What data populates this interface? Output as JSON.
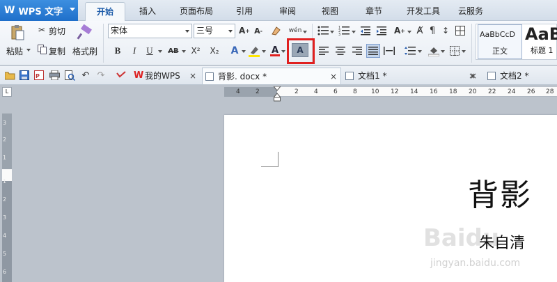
{
  "app": {
    "title": "WPS 文字"
  },
  "menu": {
    "tabs": [
      "开始",
      "插入",
      "页面布局",
      "引用",
      "审阅",
      "视图",
      "章节",
      "开发工具",
      "云服务"
    ]
  },
  "ribbon": {
    "paste_label": "粘贴",
    "cut_label": "剪切",
    "copy_label": "复制",
    "format_painter_label": "格式刷",
    "font_name": "宋体",
    "font_size": "三号",
    "bold": "B",
    "italic": "I",
    "underline": "U",
    "strikethrough": "AB",
    "superscript": "X²",
    "subscript": "X₂",
    "char_shading": "A",
    "styles": [
      {
        "preview": "AaBbCcD",
        "label": "正文"
      },
      {
        "preview": "AaB",
        "label": "标题 1"
      }
    ]
  },
  "doc_tabs": [
    {
      "name": "我的WPS",
      "close": "×"
    },
    {
      "name": "背影. docx *",
      "close": "×"
    },
    {
      "name": "文档1 *",
      "close": "×"
    },
    {
      "name": "文档2 *",
      "close": "×"
    }
  ],
  "ruler": {
    "h_ticks": [
      "4",
      "2",
      "2",
      "4",
      "6",
      "8",
      "10",
      "12",
      "14",
      "16",
      "18",
      "20",
      "22",
      "24",
      "26",
      "28"
    ],
    "v_ticks": [
      "3",
      "2",
      "1",
      "1",
      "2",
      "3",
      "4",
      "5",
      "6",
      "7"
    ]
  },
  "document": {
    "title": "背影",
    "author": "朱自清"
  },
  "watermark": {
    "brand": "Baidu",
    "url": "jingyan.baidu.com"
  },
  "colors": {
    "logo_bg": "#1f6fca",
    "highlight": "#e02020",
    "active_tab_text": "#1b5aa8"
  }
}
